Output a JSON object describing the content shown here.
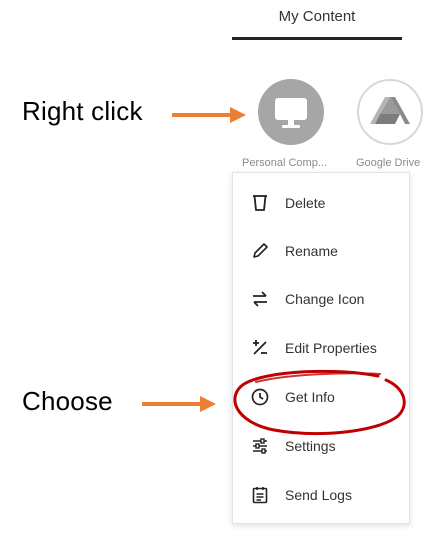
{
  "header": {
    "tab_title": "My Content"
  },
  "annotations": {
    "right_click": "Right click",
    "choose": "Choose",
    "arrow_color": "#ED7D31",
    "circle_color": "#C00000"
  },
  "tiles": [
    {
      "label": "Personal Comp...",
      "icon": "computer-monitor-icon",
      "color": "#A6A6A6"
    },
    {
      "label": "Google Drive",
      "icon": "google-drive-icon"
    }
  ],
  "context_menu": {
    "items": [
      {
        "label": "Delete",
        "icon": "trash-icon"
      },
      {
        "label": "Rename",
        "icon": "pencil-icon"
      },
      {
        "label": "Change Icon",
        "icon": "swap-arrows-icon"
      },
      {
        "label": "Edit Properties",
        "icon": "edit-properties-icon"
      },
      {
        "label": "Get Info",
        "icon": "clock-info-icon"
      },
      {
        "label": "Settings",
        "icon": "sliders-icon"
      },
      {
        "label": "Send Logs",
        "icon": "clipboard-list-icon"
      }
    ]
  }
}
